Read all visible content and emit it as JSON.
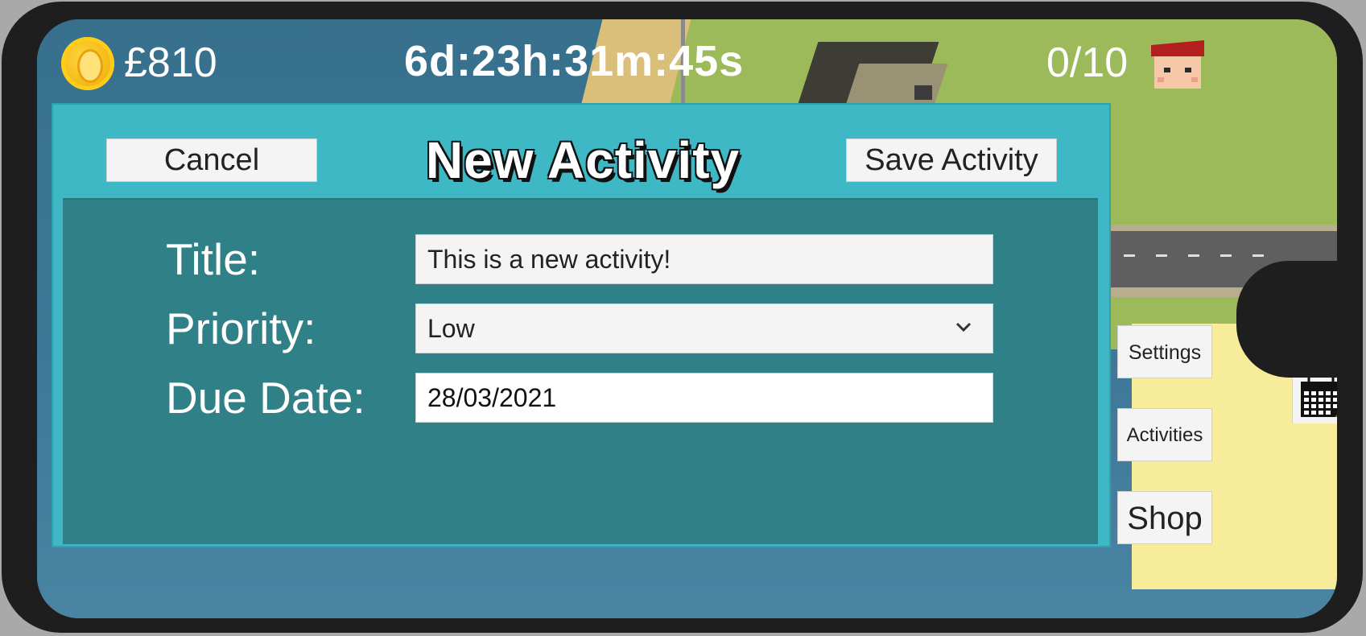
{
  "hud": {
    "money": "£810",
    "timer": "6d:23h:31m:45s",
    "workers": "0/10",
    "coin_icon": "coin-icon",
    "avatar_icon": "worker-avatar-icon"
  },
  "dialog": {
    "title": "New Activity",
    "cancel_label": "Cancel",
    "save_label": "Save Activity",
    "fields": {
      "title_label": "Title:",
      "title_value": "This is a new activity!",
      "priority_label": "Priority:",
      "priority_value": "Low",
      "due_date_label": "Due Date:",
      "due_date_value": "28/03/2021"
    }
  },
  "side_menu": {
    "settings_label": "Settings",
    "activities_label": "Activities",
    "shop_label": "Shop"
  },
  "colors": {
    "dialog_bg": "#3eb8c5",
    "dialog_inner": "#2f8187",
    "grass": "#9cba59",
    "water": "#3f7898"
  }
}
